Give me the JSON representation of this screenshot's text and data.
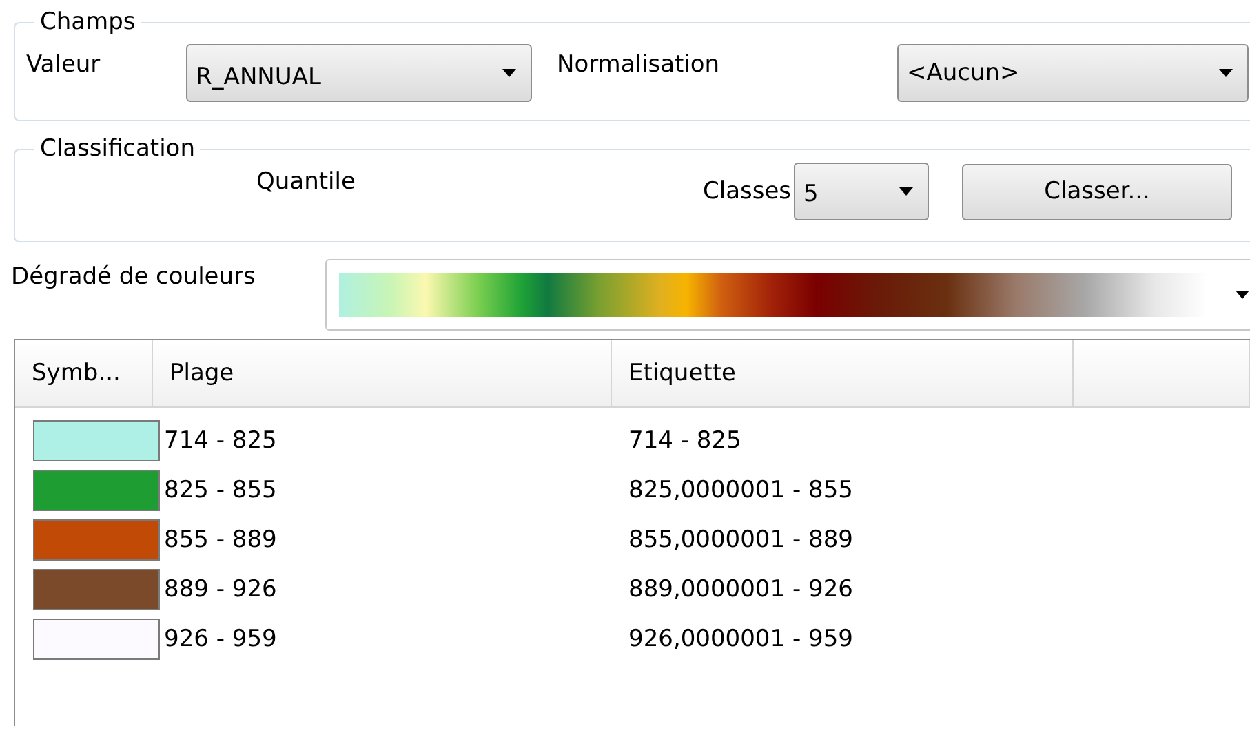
{
  "fields_group": {
    "title": "Champs",
    "value_label": "Valeur",
    "value_choice": "R_ANNUAL",
    "normalization_label": "Normalisation",
    "normalization_choice": "<Aucun>"
  },
  "classification_group": {
    "title": "Classification",
    "method": "Quantile",
    "classes_label": "Classes",
    "classes_choice": "5",
    "classify_button": "Classer..."
  },
  "color_ramp": {
    "label": "Dégradé de couleurs"
  },
  "table": {
    "columns": [
      "Symb...",
      "Plage",
      "Etiquette"
    ],
    "rows": [
      {
        "color": "#aff0e6",
        "range": "714 - 825",
        "label": "714 - 825"
      },
      {
        "color": "#1e9e32",
        "range": "825 - 855",
        "label": "825,0000001 - 855"
      },
      {
        "color": "#c04a06",
        "range": "855 - 889",
        "label": "855,0000001 - 889"
      },
      {
        "color": "#7a4a2a",
        "range": "889 - 926",
        "label": "889,0000001 - 926"
      },
      {
        "color": "#fdfaff",
        "range": "926 - 959",
        "label": "926,0000001 - 959"
      }
    ]
  }
}
